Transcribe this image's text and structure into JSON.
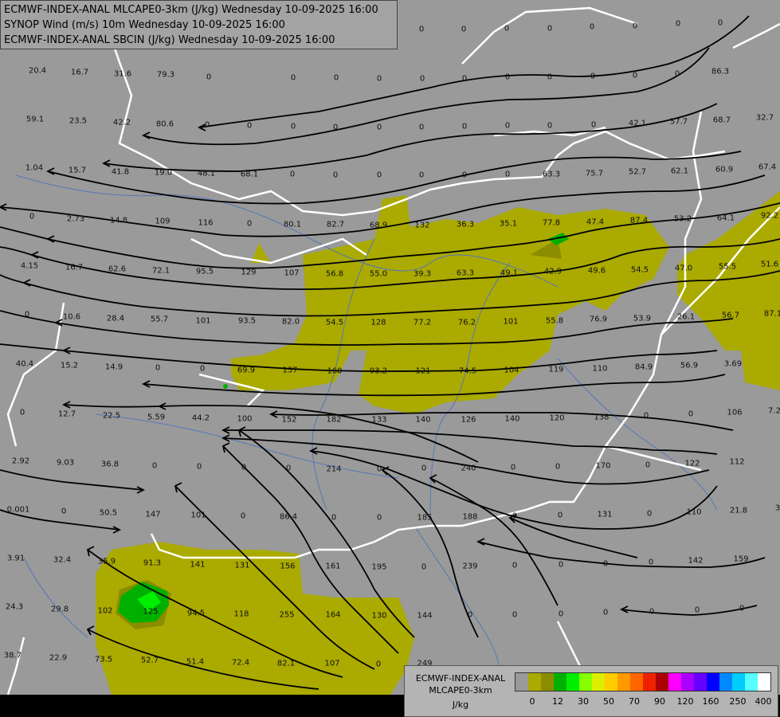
{
  "header": {
    "lines": [
      "ECMWF-INDEX-ANAL MLCAPE0-3km (J/kg) Wednesday 10-09-2025 16:00",
      "SYNOP Wind (m/s) 10m Wednesday 10-09-2025 16:00",
      "ECMWF-INDEX-ANAL SBCIN (J/kg) Wednesday 10-09-2025 16:00"
    ]
  },
  "legend": {
    "title": [
      "ECMWF-INDEX-ANAL",
      "MLCAPE0-3km"
    ],
    "unit": "J/kg",
    "colors": [
      "#9a9a9a",
      "#aaaa00",
      "#8c8c00",
      "#00b000",
      "#00ee00",
      "#88ff00",
      "#ddee00",
      "#ffcc00",
      "#ff9900",
      "#ff6600",
      "#ee2200",
      "#aa0000",
      "#ff00ff",
      "#aa00ff",
      "#6600ff",
      "#0000ff",
      "#0088ff",
      "#00ccff",
      "#55ffff",
      "#ffffff"
    ],
    "tick_labels": [
      "0",
      "12",
      "30",
      "50",
      "70",
      "90",
      "120",
      "160",
      "250",
      "400"
    ]
  },
  "map_values": [
    [
      "20.4",
      47,
      89
    ],
    [
      "16.7",
      100,
      91
    ],
    [
      "31.6",
      154,
      93
    ],
    [
      "79.3",
      208,
      94
    ],
    [
      "0",
      262,
      97
    ],
    [
      "0",
      368,
      98
    ],
    [
      "0",
      422,
      98
    ],
    [
      "0",
      476,
      99
    ],
    [
      "0",
      530,
      99
    ],
    [
      "0",
      583,
      99
    ],
    [
      "0",
      637,
      97
    ],
    [
      "0",
      690,
      97
    ],
    [
      "0",
      744,
      96
    ],
    [
      "0",
      797,
      95
    ],
    [
      "0",
      850,
      93
    ],
    [
      "86.3",
      904,
      90
    ],
    [
      "0",
      529,
      37
    ],
    [
      "0",
      582,
      37
    ],
    [
      "0",
      636,
      36
    ],
    [
      "0",
      690,
      36
    ],
    [
      "0",
      743,
      34
    ],
    [
      "0",
      797,
      33
    ],
    [
      "0",
      851,
      30
    ],
    [
      "0",
      904,
      29
    ],
    [
      "0",
      425,
      37
    ],
    [
      "59.1",
      44,
      150
    ],
    [
      "23.5",
      98,
      152
    ],
    [
      "42.2",
      153,
      154
    ],
    [
      "80.6",
      207,
      156
    ],
    [
      "0",
      260,
      157
    ],
    [
      "0",
      313,
      158
    ],
    [
      "0",
      368,
      159
    ],
    [
      "0",
      421,
      160
    ],
    [
      "0",
      476,
      160
    ],
    [
      "0",
      529,
      160
    ],
    [
      "0",
      583,
      159
    ],
    [
      "0",
      637,
      158
    ],
    [
      "0",
      690,
      158
    ],
    [
      "0",
      745,
      157
    ],
    [
      "42.1",
      800,
      155
    ],
    [
      "57.7",
      852,
      153
    ],
    [
      "68.7",
      906,
      151
    ],
    [
      "32.7",
      960,
      148
    ],
    [
      "1.04",
      43,
      211
    ],
    [
      "15.7",
      97,
      214
    ],
    [
      "41.8",
      151,
      216
    ],
    [
      "19.0",
      205,
      217
    ],
    [
      "48.1",
      259,
      218
    ],
    [
      "68.1",
      313,
      219
    ],
    [
      "0",
      367,
      219
    ],
    [
      "0",
      421,
      220
    ],
    [
      "0",
      476,
      220
    ],
    [
      "0",
      529,
      220
    ],
    [
      "0",
      583,
      220
    ],
    [
      "0",
      637,
      219
    ],
    [
      "63.3",
      692,
      219
    ],
    [
      "75.7",
      746,
      218
    ],
    [
      "52.7",
      800,
      216
    ],
    [
      "62.1",
      853,
      215
    ],
    [
      "60.9",
      909,
      213
    ],
    [
      "67.4",
      963,
      210
    ],
    [
      "0",
      40,
      272
    ],
    [
      "2.73",
      95,
      275
    ],
    [
      "14.8",
      149,
      277
    ],
    [
      "109",
      204,
      278
    ],
    [
      "116",
      258,
      280
    ],
    [
      "0",
      313,
      281
    ],
    [
      "80.1",
      367,
      282
    ],
    [
      "82.7",
      421,
      282
    ],
    [
      "68.9",
      475,
      283
    ],
    [
      "132",
      530,
      283
    ],
    [
      "36.3",
      584,
      282
    ],
    [
      "35.1",
      638,
      281
    ],
    [
      "77.8",
      692,
      280
    ],
    [
      "47.4",
      747,
      279
    ],
    [
      "87.4",
      802,
      277
    ],
    [
      "53.2",
      857,
      275
    ],
    [
      "64.1",
      911,
      274
    ],
    [
      "92.2",
      966,
      271
    ],
    [
      "4.15",
      37,
      334
    ],
    [
      "16.7",
      93,
      336
    ],
    [
      "62.6",
      147,
      338
    ],
    [
      "72.1",
      202,
      340
    ],
    [
      "95.5",
      257,
      341
    ],
    [
      "129",
      312,
      342
    ],
    [
      "107",
      366,
      343
    ],
    [
      "56.8",
      420,
      344
    ],
    [
      "55.0",
      475,
      344
    ],
    [
      "39.3",
      530,
      344
    ],
    [
      "63.3",
      584,
      343
    ],
    [
      "49.1",
      639,
      343
    ],
    [
      "42.9",
      694,
      341
    ],
    [
      "49.6",
      749,
      340
    ],
    [
      "54.5",
      803,
      339
    ],
    [
      "47.0",
      858,
      337
    ],
    [
      "55.5",
      913,
      335
    ],
    [
      "51.6",
      966,
      332
    ],
    [
      "0",
      34,
      395
    ],
    [
      "10.6",
      90,
      398
    ],
    [
      "28.4",
      145,
      400
    ],
    [
      "55.7",
      200,
      401
    ],
    [
      "101",
      255,
      403
    ],
    [
      "93.5",
      310,
      403
    ],
    [
      "82.0",
      365,
      404
    ],
    [
      "54.5",
      420,
      405
    ],
    [
      "128",
      475,
      405
    ],
    [
      "77.2",
      530,
      405
    ],
    [
      "76.2",
      586,
      405
    ],
    [
      "101",
      641,
      404
    ],
    [
      "55.8",
      696,
      403
    ],
    [
      "76.9",
      751,
      401
    ],
    [
      "53.9",
      806,
      400
    ],
    [
      "26.1",
      861,
      398
    ],
    [
      "56.7",
      917,
      396
    ],
    [
      "87.1",
      970,
      394
    ],
    [
      "40.4",
      31,
      457
    ],
    [
      "15.2",
      87,
      459
    ],
    [
      "14.9",
      143,
      461
    ],
    [
      "0",
      198,
      462
    ],
    [
      "0",
      254,
      463
    ],
    [
      "69.9",
      309,
      465
    ],
    [
      "137",
      364,
      465
    ],
    [
      "160",
      420,
      466
    ],
    [
      "93.2",
      475,
      466
    ],
    [
      "121",
      531,
      466
    ],
    [
      "74.5",
      587,
      466
    ],
    [
      "104",
      642,
      465
    ],
    [
      "119",
      698,
      464
    ],
    [
      "110",
      753,
      463
    ],
    [
      "84.9",
      808,
      461
    ],
    [
      "56.9",
      865,
      459
    ],
    [
      "3.69",
      920,
      457
    ],
    [
      "0",
      28,
      518
    ],
    [
      "12.7",
      84,
      520
    ],
    [
      "22.5",
      140,
      522
    ],
    [
      "5.59",
      196,
      524
    ],
    [
      "44.2",
      252,
      525
    ],
    [
      "100",
      307,
      526
    ],
    [
      "152",
      363,
      527
    ],
    [
      "182",
      419,
      527
    ],
    [
      "133",
      476,
      527
    ],
    [
      "140",
      531,
      527
    ],
    [
      "126",
      588,
      527
    ],
    [
      "140",
      643,
      526
    ],
    [
      "120",
      699,
      525
    ],
    [
      "138",
      755,
      524
    ],
    [
      "0",
      811,
      522
    ],
    [
      "0",
      867,
      520
    ],
    [
      "106",
      922,
      518
    ],
    [
      "7.2",
      972,
      516
    ],
    [
      "2.92",
      26,
      579
    ],
    [
      "9.03",
      82,
      581
    ],
    [
      "36.8",
      138,
      583
    ],
    [
      "0",
      194,
      585
    ],
    [
      "0",
      250,
      586
    ],
    [
      "0",
      306,
      587
    ],
    [
      "0",
      362,
      588
    ],
    [
      "214",
      419,
      589
    ],
    [
      "0",
      476,
      589
    ],
    [
      "0",
      532,
      588
    ],
    [
      "240",
      588,
      588
    ],
    [
      "0",
      644,
      587
    ],
    [
      "0",
      700,
      586
    ],
    [
      "170",
      757,
      585
    ],
    [
      "0",
      813,
      584
    ],
    [
      "122",
      869,
      582
    ],
    [
      "112",
      925,
      580
    ],
    [
      "0.001",
      23,
      640
    ],
    [
      "0",
      80,
      642
    ],
    [
      "50.5",
      136,
      644
    ],
    [
      "147",
      192,
      646
    ],
    [
      "101",
      249,
      647
    ],
    [
      "0",
      305,
      648
    ],
    [
      "86.4",
      362,
      649
    ],
    [
      "0",
      419,
      650
    ],
    [
      "0",
      476,
      650
    ],
    [
      "185",
      533,
      650
    ],
    [
      "188",
      590,
      649
    ],
    [
      "0",
      646,
      648
    ],
    [
      "0",
      703,
      647
    ],
    [
      "131",
      759,
      646
    ],
    [
      "0",
      815,
      645
    ],
    [
      "110",
      871,
      643
    ],
    [
      "21.8",
      927,
      641
    ],
    [
      "3",
      976,
      638
    ],
    [
      "3.91",
      20,
      701
    ],
    [
      "32.4",
      78,
      703
    ],
    [
      "35.9",
      134,
      705
    ],
    [
      "91.3",
      191,
      707
    ],
    [
      "141",
      248,
      709
    ],
    [
      "131",
      304,
      710
    ],
    [
      "156",
      361,
      711
    ],
    [
      "161",
      418,
      711
    ],
    [
      "195",
      476,
      712
    ],
    [
      "0",
      532,
      712
    ],
    [
      "239",
      590,
      711
    ],
    [
      "0",
      646,
      710
    ],
    [
      "0",
      704,
      709
    ],
    [
      "0",
      760,
      708
    ],
    [
      "0",
      817,
      706
    ],
    [
      "142",
      873,
      704
    ],
    [
      "159",
      930,
      702
    ],
    [
      "24.3",
      18,
      762
    ],
    [
      "29.8",
      75,
      765
    ],
    [
      "102",
      132,
      767
    ],
    [
      "125",
      189,
      768
    ],
    [
      "94.5",
      246,
      770
    ],
    [
      "118",
      303,
      771
    ],
    [
      "255",
      360,
      772
    ],
    [
      "164",
      418,
      772
    ],
    [
      "130",
      476,
      773
    ],
    [
      "144",
      533,
      773
    ],
    [
      "0",
      590,
      772
    ],
    [
      "0",
      646,
      772
    ],
    [
      "0",
      704,
      771
    ],
    [
      "0",
      760,
      769
    ],
    [
      "0",
      818,
      768
    ],
    [
      "0",
      875,
      766
    ],
    [
      "0",
      931,
      764
    ],
    [
      "38.7",
      16,
      823
    ],
    [
      "22.9",
      73,
      826
    ],
    [
      "73.5",
      130,
      828
    ],
    [
      "52.7",
      188,
      829
    ],
    [
      "51.4",
      245,
      831
    ],
    [
      "72.4",
      302,
      832
    ],
    [
      "82.1",
      359,
      833
    ],
    [
      "107",
      417,
      833
    ],
    [
      "0",
      475,
      834
    ],
    [
      "249",
      533,
      833
    ]
  ]
}
